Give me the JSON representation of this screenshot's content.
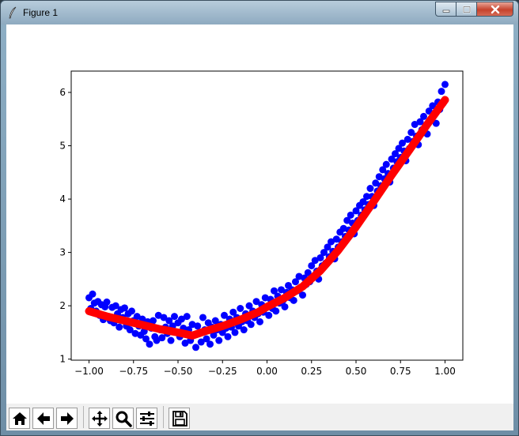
{
  "window": {
    "title": "Figure 1",
    "controls": [
      "minimize-icon",
      "maximize-icon",
      "close-icon"
    ]
  },
  "toolbar": {
    "buttons": [
      {
        "name": "home-button",
        "icon": "home-icon"
      },
      {
        "name": "back-button",
        "icon": "arrow-left-icon"
      },
      {
        "name": "forward-button",
        "icon": "arrow-right-icon"
      },
      {
        "name": "pan-button",
        "icon": "move-icon"
      },
      {
        "name": "zoom-button",
        "icon": "magnifier-icon"
      },
      {
        "name": "configure-subplots-button",
        "icon": "sliders-icon"
      },
      {
        "name": "save-button",
        "icon": "floppy-disk-icon"
      }
    ]
  },
  "colors": {
    "scatter": "#0000ff",
    "fit_line": "#ff0000",
    "axes": "#000000",
    "background": "#ffffff",
    "toolbar": "#f0f0f0"
  },
  "chart_data": {
    "type": "scatter",
    "title": "",
    "xlabel": "",
    "ylabel": "",
    "xlim": [
      -1.1,
      1.1
    ],
    "ylim": [
      0.98,
      6.4
    ],
    "xticks": [
      -1.0,
      -0.75,
      -0.5,
      -0.25,
      0.0,
      0.25,
      0.5,
      0.75,
      1.0
    ],
    "xtick_labels": [
      "−1.00",
      "−0.75",
      "−0.50",
      "−0.25",
      "0.00",
      "0.25",
      "0.50",
      "0.75",
      "1.00"
    ],
    "yticks": [
      1,
      2,
      3,
      4,
      5,
      6
    ],
    "ytick_labels": [
      "1",
      "2",
      "3",
      "4",
      "5",
      "6"
    ],
    "grid": false,
    "legend": "none",
    "series": [
      {
        "kind": "scatter",
        "color": "#0000ff",
        "points": [
          [
            -1.0,
            2.15
          ],
          [
            -0.99,
            1.95
          ],
          [
            -0.98,
            2.22
          ],
          [
            -0.97,
            2.05
          ],
          [
            -0.96,
            1.9
          ],
          [
            -0.95,
            2.08
          ],
          [
            -0.94,
            1.82
          ],
          [
            -0.93,
            2.02
          ],
          [
            -0.92,
            1.74
          ],
          [
            -0.91,
            1.98
          ],
          [
            -0.9,
            2.07
          ],
          [
            -0.89,
            1.8
          ],
          [
            -0.88,
            1.72
          ],
          [
            -0.87,
            1.97
          ],
          [
            -0.86,
            1.68
          ],
          [
            -0.85,
            2.0
          ],
          [
            -0.84,
            1.85
          ],
          [
            -0.83,
            1.6
          ],
          [
            -0.82,
            1.93
          ],
          [
            -0.81,
            1.78
          ],
          [
            -0.8,
            1.96
          ],
          [
            -0.79,
            1.62
          ],
          [
            -0.78,
            1.85
          ],
          [
            -0.77,
            1.55
          ],
          [
            -0.76,
            1.9
          ],
          [
            -0.75,
            1.72
          ],
          [
            -0.74,
            1.48
          ],
          [
            -0.73,
            1.8
          ],
          [
            -0.72,
            1.62
          ],
          [
            -0.71,
            1.45
          ],
          [
            -0.7,
            1.75
          ],
          [
            -0.69,
            1.52
          ],
          [
            -0.68,
            1.38
          ],
          [
            -0.67,
            1.7
          ],
          [
            -0.66,
            1.28
          ],
          [
            -0.65,
            1.58
          ],
          [
            -0.64,
            1.72
          ],
          [
            -0.63,
            1.42
          ],
          [
            -0.62,
            1.35
          ],
          [
            -0.61,
            1.82
          ],
          [
            -0.6,
            1.55
          ],
          [
            -0.59,
            1.4
          ],
          [
            -0.58,
            1.78
          ],
          [
            -0.57,
            1.6
          ],
          [
            -0.56,
            1.48
          ],
          [
            -0.55,
            1.72
          ],
          [
            -0.54,
            1.35
          ],
          [
            -0.53,
            1.62
          ],
          [
            -0.52,
            1.8
          ],
          [
            -0.51,
            1.5
          ],
          [
            -0.5,
            1.68
          ],
          [
            -0.49,
            1.42
          ],
          [
            -0.48,
            1.75
          ],
          [
            -0.47,
            1.58
          ],
          [
            -0.46,
            1.3
          ],
          [
            -0.45,
            1.8
          ],
          [
            -0.44,
            1.55
          ],
          [
            -0.43,
            1.35
          ],
          [
            -0.42,
            1.65
          ],
          [
            -0.41,
            1.45
          ],
          [
            -0.4,
            1.22
          ],
          [
            -0.39,
            1.62
          ],
          [
            -0.38,
            1.5
          ],
          [
            -0.37,
            1.32
          ],
          [
            -0.36,
            1.78
          ],
          [
            -0.35,
            1.55
          ],
          [
            -0.34,
            1.38
          ],
          [
            -0.33,
            1.68
          ],
          [
            -0.32,
            1.28
          ],
          [
            -0.31,
            1.6
          ],
          [
            -0.3,
            1.45
          ],
          [
            -0.29,
            1.72
          ],
          [
            -0.28,
            1.55
          ],
          [
            -0.27,
            1.35
          ],
          [
            -0.26,
            1.65
          ],
          [
            -0.25,
            1.5
          ],
          [
            -0.24,
            1.82
          ],
          [
            -0.23,
            1.58
          ],
          [
            -0.22,
            1.42
          ],
          [
            -0.21,
            1.75
          ],
          [
            -0.2,
            1.6
          ],
          [
            -0.19,
            1.88
          ],
          [
            -0.18,
            1.5
          ],
          [
            -0.17,
            1.78
          ],
          [
            -0.16,
            1.62
          ],
          [
            -0.15,
            1.95
          ],
          [
            -0.14,
            1.7
          ],
          [
            -0.13,
            1.55
          ],
          [
            -0.12,
            1.85
          ],
          [
            -0.11,
            1.72
          ],
          [
            -0.1,
            2.0
          ],
          [
            -0.09,
            1.65
          ],
          [
            -0.08,
            1.9
          ],
          [
            -0.07,
            1.78
          ],
          [
            -0.06,
            2.08
          ],
          [
            -0.05,
            1.85
          ],
          [
            -0.04,
            1.7
          ],
          [
            -0.03,
            2.02
          ],
          [
            -0.02,
            1.88
          ],
          [
            -0.01,
            2.15
          ],
          [
            0.0,
            1.98
          ],
          [
            0.01,
            1.82
          ],
          [
            0.02,
            2.12
          ],
          [
            0.03,
            1.95
          ],
          [
            0.04,
            2.28
          ],
          [
            0.05,
            1.9
          ],
          [
            0.06,
            2.18
          ],
          [
            0.07,
            2.05
          ],
          [
            0.08,
            2.3
          ],
          [
            0.09,
            2.1
          ],
          [
            0.1,
            1.98
          ],
          [
            0.11,
            2.25
          ],
          [
            0.12,
            2.38
          ],
          [
            0.13,
            2.15
          ],
          [
            0.14,
            2.3
          ],
          [
            0.15,
            2.1
          ],
          [
            0.16,
            2.45
          ],
          [
            0.17,
            2.28
          ],
          [
            0.18,
            2.55
          ],
          [
            0.19,
            2.35
          ],
          [
            0.2,
            2.2
          ],
          [
            0.21,
            2.52
          ],
          [
            0.22,
            2.4
          ],
          [
            0.23,
            2.62
          ],
          [
            0.24,
            2.45
          ],
          [
            0.25,
            2.75
          ],
          [
            0.26,
            2.55
          ],
          [
            0.27,
            2.85
          ],
          [
            0.28,
            2.65
          ],
          [
            0.29,
            2.5
          ],
          [
            0.3,
            2.9
          ],
          [
            0.31,
            2.75
          ],
          [
            0.32,
            3.0
          ],
          [
            0.33,
            2.8
          ],
          [
            0.34,
            3.1
          ],
          [
            0.35,
            2.92
          ],
          [
            0.36,
            3.2
          ],
          [
            0.37,
            3.02
          ],
          [
            0.38,
            2.88
          ],
          [
            0.39,
            3.25
          ],
          [
            0.4,
            3.1
          ],
          [
            0.41,
            3.38
          ],
          [
            0.42,
            3.2
          ],
          [
            0.43,
            3.45
          ],
          [
            0.44,
            3.3
          ],
          [
            0.45,
            3.6
          ],
          [
            0.46,
            3.42
          ],
          [
            0.47,
            3.7
          ],
          [
            0.48,
            3.55
          ],
          [
            0.49,
            3.35
          ],
          [
            0.5,
            3.78
          ],
          [
            0.51,
            3.6
          ],
          [
            0.52,
            3.88
          ],
          [
            0.53,
            3.7
          ],
          [
            0.54,
            3.95
          ],
          [
            0.55,
            3.8
          ],
          [
            0.56,
            4.05
          ],
          [
            0.57,
            3.9
          ],
          [
            0.58,
            4.2
          ],
          [
            0.59,
            4.05
          ],
          [
            0.6,
            3.88
          ],
          [
            0.61,
            4.3
          ],
          [
            0.62,
            4.15
          ],
          [
            0.63,
            4.42
          ],
          [
            0.64,
            4.25
          ],
          [
            0.65,
            4.55
          ],
          [
            0.66,
            4.38
          ],
          [
            0.67,
            4.65
          ],
          [
            0.68,
            4.48
          ],
          [
            0.69,
            4.32
          ],
          [
            0.7,
            4.75
          ],
          [
            0.71,
            4.58
          ],
          [
            0.72,
            4.85
          ],
          [
            0.73,
            4.7
          ],
          [
            0.74,
            4.95
          ],
          [
            0.75,
            4.78
          ],
          [
            0.76,
            5.05
          ],
          [
            0.77,
            4.9
          ],
          [
            0.78,
            4.72
          ],
          [
            0.79,
            5.12
          ],
          [
            0.8,
            4.95
          ],
          [
            0.81,
            5.25
          ],
          [
            0.82,
            5.08
          ],
          [
            0.83,
            5.4
          ],
          [
            0.84,
            5.18
          ],
          [
            0.85,
            5.02
          ],
          [
            0.86,
            5.45
          ],
          [
            0.87,
            5.3
          ],
          [
            0.88,
            5.55
          ],
          [
            0.89,
            5.38
          ],
          [
            0.9,
            5.22
          ],
          [
            0.91,
            5.65
          ],
          [
            0.92,
            5.48
          ],
          [
            0.93,
            5.75
          ],
          [
            0.94,
            5.58
          ],
          [
            0.95,
            5.42
          ],
          [
            0.96,
            5.82
          ],
          [
            0.97,
            5.68
          ],
          [
            0.98,
            6.02
          ],
          [
            0.99,
            5.8
          ],
          [
            1.0,
            6.15
          ]
        ]
      },
      {
        "kind": "line",
        "color": "#ff0000",
        "points": [
          [
            -1.0,
            1.9
          ],
          [
            -0.9,
            1.8
          ],
          [
            -0.8,
            1.72
          ],
          [
            -0.7,
            1.64
          ],
          [
            -0.6,
            1.56
          ],
          [
            -0.5,
            1.5
          ],
          [
            -0.42,
            1.44
          ],
          [
            -0.35,
            1.52
          ],
          [
            -0.25,
            1.62
          ],
          [
            -0.15,
            1.74
          ],
          [
            -0.05,
            1.88
          ],
          [
            0.0,
            1.98
          ],
          [
            0.1,
            2.15
          ],
          [
            0.2,
            2.36
          ],
          [
            0.3,
            2.66
          ],
          [
            0.4,
            3.04
          ],
          [
            0.5,
            3.48
          ],
          [
            0.6,
            3.96
          ],
          [
            0.7,
            4.45
          ],
          [
            0.8,
            4.92
          ],
          [
            0.9,
            5.4
          ],
          [
            1.0,
            5.86
          ]
        ]
      }
    ]
  }
}
